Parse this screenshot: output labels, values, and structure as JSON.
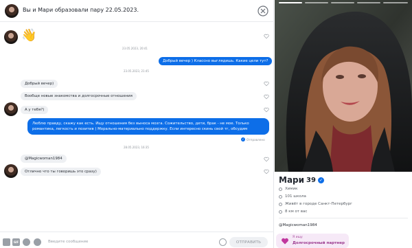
{
  "header": {
    "title": "Вы и Мари образовали пару 22.05.2023."
  },
  "messages": {
    "date1": "23.05.2023, 20:41",
    "out1": "Добрый вечер ) Классно выглядишь. Какие цели тут?",
    "date2": "23.05.2023, 21:45",
    "in1": "Добрый вечер)",
    "in2": "Вообще новые знакомства и долгосрочные отношения",
    "in3": "А у тебя?)",
    "out2": "Люблю правду, скажу как есть. Ищу отношения без выноса мозга. Сожительство, дети, брак - не мое. Только романтика, легкость и позитив ) Морально-материально поддержку. Если интересно скинь свой тг, обсудим",
    "sent_status": "Отправлено",
    "date3": "28.05.2023, 16:35",
    "in4": "@Magicwoman1984",
    "in5": "Отлично что ты говоришь это сразу)"
  },
  "composer": {
    "placeholder": "Введите сообщение",
    "send_label": "ОТПРАВИТЬ",
    "gif_label": "GIF"
  },
  "profile": {
    "name": "Мари",
    "age": "39",
    "job": "Химик",
    "school": "101 школа",
    "city": "Живёт в городе Санкт-Петербург",
    "distance": "8 км от вас",
    "bio": "@Magicwoman1984",
    "seeking_label": "Я ищу",
    "seeking_value": "Долгосрочный партнер",
    "photo_count": 5,
    "current_photo": 1
  },
  "colors": {
    "accent": "#0d6ee8",
    "incoming_bubble": "#eef0f3",
    "seeking_bg": "#f6e9f7"
  }
}
